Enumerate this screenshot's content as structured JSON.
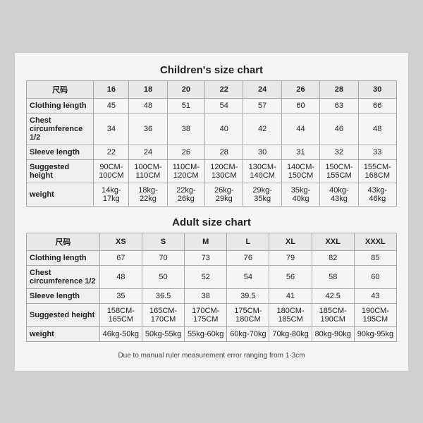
{
  "children_chart": {
    "title": "Children's size chart",
    "columns": [
      "尺码",
      "16",
      "18",
      "20",
      "22",
      "24",
      "26",
      "28",
      "30"
    ],
    "rows": [
      {
        "label": "Clothing length",
        "values": [
          "45",
          "48",
          "51",
          "54",
          "57",
          "60",
          "63",
          "66"
        ]
      },
      {
        "label": "Chest circumference 1/2",
        "values": [
          "34",
          "36",
          "38",
          "40",
          "42",
          "44",
          "46",
          "48"
        ]
      },
      {
        "label": "Sleeve length",
        "values": [
          "22",
          "24",
          "26",
          "28",
          "30",
          "31",
          "32",
          "33"
        ]
      },
      {
        "label": "Suggested height",
        "values": [
          "90CM-100CM",
          "100CM-110CM",
          "110CM-120CM",
          "120CM-130CM",
          "130CM-140CM",
          "140CM-150CM",
          "150CM-155CM",
          "155CM-168CM"
        ]
      },
      {
        "label": "weight",
        "values": [
          "14kg-17kg",
          "18kg-22kg",
          "22kg-26kg",
          "26kg-29kg",
          "29kg-35kg",
          "35kg-40kg",
          "40kg-43kg",
          "43kg-46kg"
        ]
      }
    ]
  },
  "adult_chart": {
    "title": "Adult size chart",
    "columns": [
      "尺码",
      "XS",
      "S",
      "M",
      "L",
      "XL",
      "XXL",
      "XXXL"
    ],
    "rows": [
      {
        "label": "Clothing length",
        "values": [
          "67",
          "70",
          "73",
          "76",
          "79",
          "82",
          "85"
        ]
      },
      {
        "label": "Chest circumference 1/2",
        "values": [
          "48",
          "50",
          "52",
          "54",
          "56",
          "58",
          "60"
        ]
      },
      {
        "label": "Sleeve length",
        "values": [
          "35",
          "36.5",
          "38",
          "39.5",
          "41",
          "42.5",
          "43"
        ]
      },
      {
        "label": "Suggested height",
        "values": [
          "158CM-165CM",
          "165CM-170CM",
          "170CM-175CM",
          "175CM-180CM",
          "180CM-185CM",
          "185CM-190CM",
          "190CM-195CM"
        ]
      },
      {
        "label": "weight",
        "values": [
          "46kg-50kg",
          "50kg-55kg",
          "55kg-60kg",
          "60kg-70kg",
          "70kg-80kg",
          "80kg-90kg",
          "90kg-95kg"
        ]
      }
    ]
  },
  "note": "Due to manual ruler measurement error ranging from 1-3cm"
}
